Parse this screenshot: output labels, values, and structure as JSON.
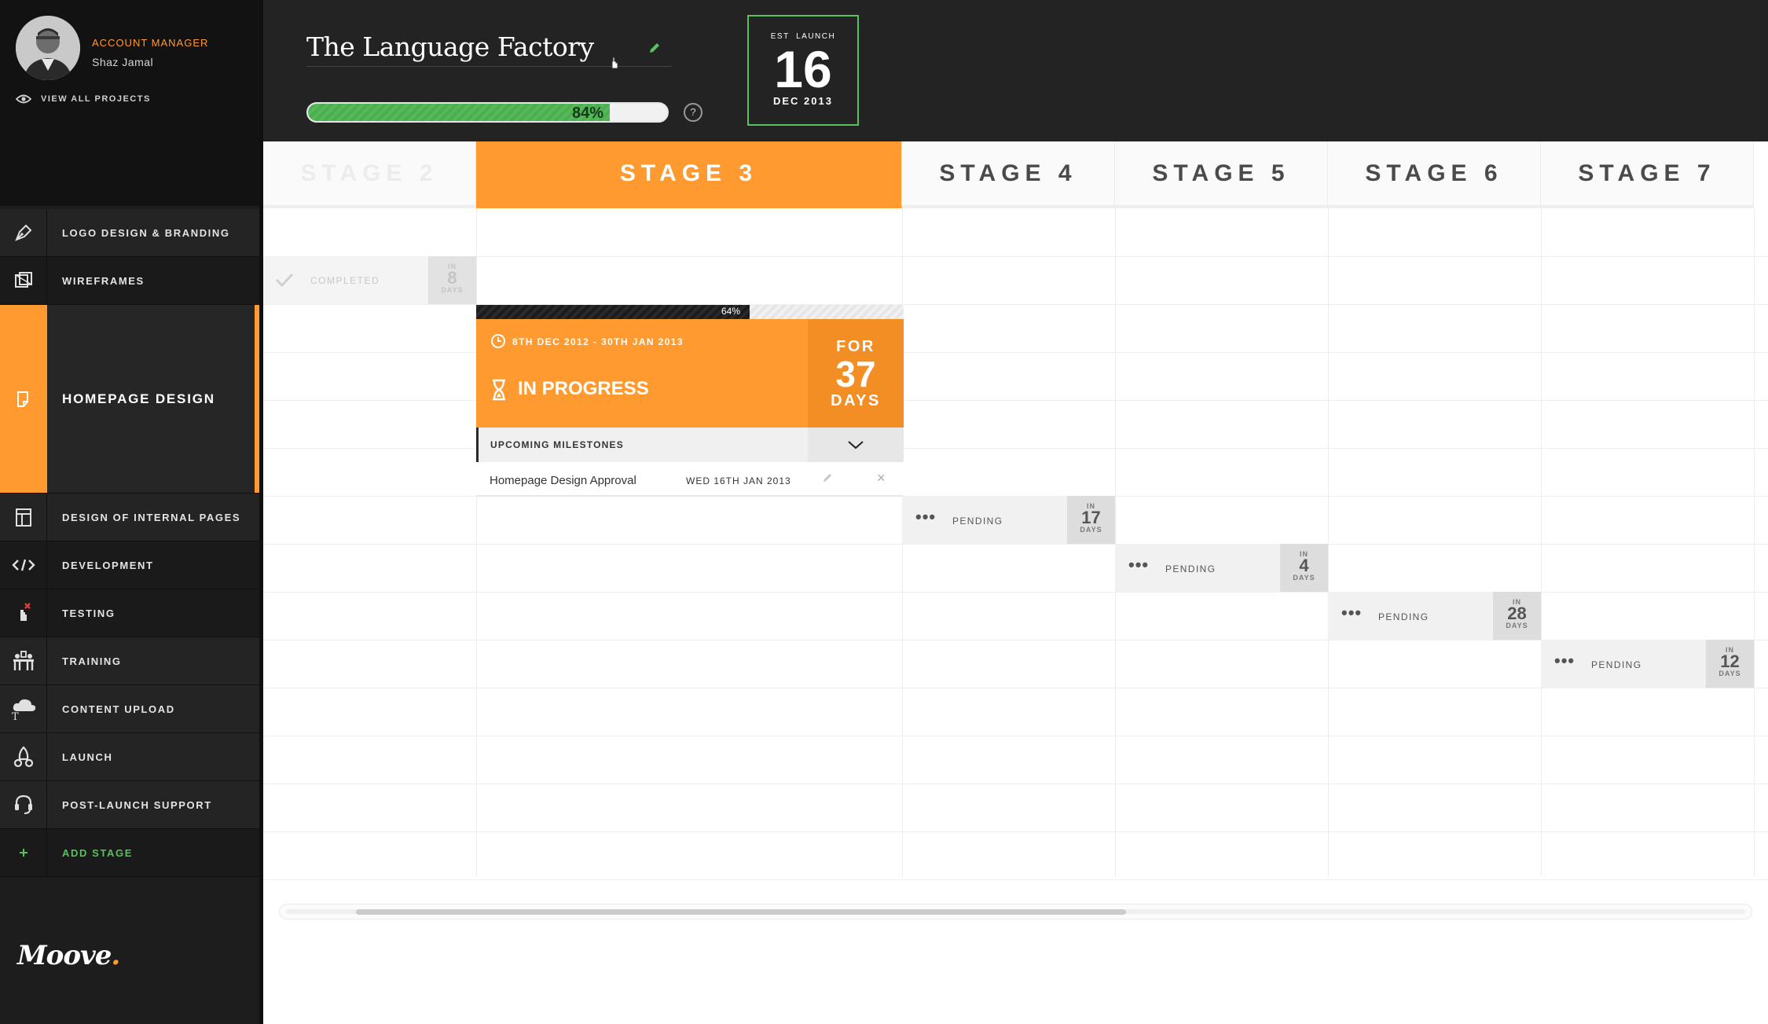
{
  "account": {
    "label": "ACCOUNT MANAGER",
    "name": "Shaz Jamal",
    "view_all": "VIEW ALL PROJECTS"
  },
  "nav": {
    "items": [
      {
        "label": "LOGO DESIGN & BRANDING",
        "icon": "pen-icon"
      },
      {
        "label": "WIREFRAMES",
        "icon": "wireframe-icon"
      },
      {
        "label": "HOMEPAGE DESIGN",
        "icon": "page-icon",
        "active": true
      },
      {
        "label": "DESIGN OF INTERNAL PAGES",
        "icon": "layout-icon"
      },
      {
        "label": "DEVELOPMENT",
        "icon": "code-icon"
      },
      {
        "label": "TESTING",
        "icon": "testing-icon"
      },
      {
        "label": "TRAINING",
        "icon": "training-icon"
      },
      {
        "label": "CONTENT UPLOAD",
        "icon": "cloud-upload-icon"
      },
      {
        "label": "LAUNCH",
        "icon": "rocket-icon"
      },
      {
        "label": "POST-LAUNCH SUPPORT",
        "icon": "headset-icon"
      }
    ],
    "add_stage": "ADD STAGE"
  },
  "brand": {
    "name": "Moove",
    "dot": "."
  },
  "project": {
    "title": "The Language Factory",
    "progress": 84,
    "progress_label": "84%",
    "help": "?"
  },
  "launch": {
    "label": "EST  LAUNCH",
    "day": "16",
    "month_year": "DEC 2013"
  },
  "stages": [
    "STAGE 2",
    "STAGE 3",
    "STAGE 4",
    "STAGE 5",
    "STAGE 6",
    "STAGE 7"
  ],
  "completed": {
    "text": "COMPLETED",
    "in": "IN",
    "days_num": "8",
    "days": "DAYS"
  },
  "task": {
    "progress": 64,
    "progress_label": "64%",
    "dates": "8TH DEC 2012 - 30TH JAN 2013",
    "status": "IN PROGRESS",
    "for": "FOR",
    "days_num": "37",
    "days": "DAYS",
    "milestones_label": "UPCOMING MILESTONES",
    "milestone_name": "Homepage Design Approval",
    "milestone_date": "WED 16TH JAN 2013",
    "close": "×"
  },
  "pending": [
    {
      "text": "PENDING",
      "in": "IN",
      "days_num": "17",
      "days": "DAYS"
    },
    {
      "text": "PENDING",
      "in": "IN",
      "days_num": "4",
      "days": "DAYS"
    },
    {
      "text": "PENDING",
      "in": "IN",
      "days_num": "28",
      "days": "DAYS"
    },
    {
      "text": "PENDING",
      "in": "IN",
      "days_num": "12",
      "days": "DAYS"
    }
  ],
  "colors": {
    "accent": "#ff9a30",
    "green": "#58c05c",
    "dark": "#1d1d1d"
  }
}
